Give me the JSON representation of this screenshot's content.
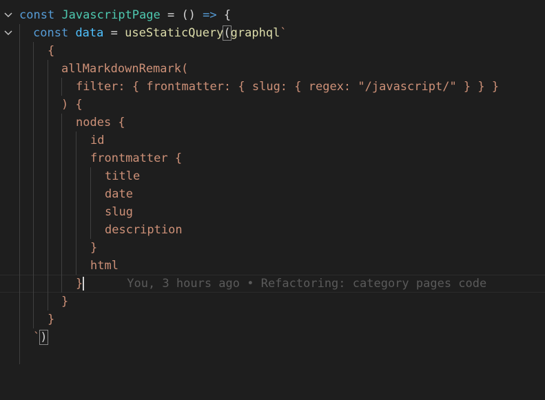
{
  "editor": {
    "lines": [
      {
        "kw": "const",
        "name": "JavascriptPage",
        "rest": " = () ",
        "arrow": "=>",
        "tail": " {"
      },
      {
        "kw": "const",
        "name": "data",
        "eq": " = ",
        "fn": "useStaticQuery",
        "paren": "(",
        "tag": "graphql",
        "tick": "`"
      },
      {
        "text": "{"
      },
      {
        "text": "allMarkdownRemark("
      },
      {
        "text": "filter: { frontmatter: { slug: { regex: \"/javascript/\" } } }"
      },
      {
        "text": ") {"
      },
      {
        "text": "nodes {"
      },
      {
        "text": "id"
      },
      {
        "text": "frontmatter {"
      },
      {
        "text": "title"
      },
      {
        "text": "date"
      },
      {
        "text": "slug"
      },
      {
        "text": "description"
      },
      {
        "text": "}"
      },
      {
        "text": "html"
      },
      {
        "text": "}",
        "blame": "You, 3 hours ago • Refactoring: category pages code"
      },
      {
        "text": "}"
      },
      {
        "text": "}"
      },
      {
        "tick": "`",
        "text": ")"
      }
    ]
  }
}
